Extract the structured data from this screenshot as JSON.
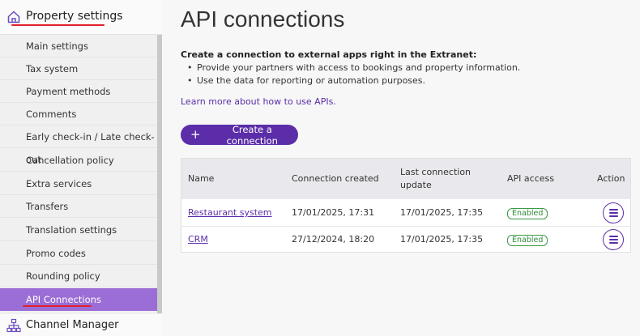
{
  "sidebar": {
    "header_title": "Property settings",
    "items": [
      {
        "label": "Main settings"
      },
      {
        "label": "Tax system"
      },
      {
        "label": "Payment methods"
      },
      {
        "label": "Comments"
      },
      {
        "label": "Early check-in / Late check-out"
      },
      {
        "label": "Cancellation policy"
      },
      {
        "label": "Extra services"
      },
      {
        "label": "Transfers"
      },
      {
        "label": "Translation settings"
      },
      {
        "label": "Promo codes"
      },
      {
        "label": "Rounding policy"
      },
      {
        "label": "API Connections"
      }
    ],
    "active_item": "API Connections",
    "footer_label": "Channel Manager",
    "active_color": "#9b6dd6"
  },
  "main": {
    "title": "API connections",
    "intro": "Create a connection to external apps right in the Extranet:",
    "bullets": [
      "Provide your partners with access to bookings and property information.",
      "Use the data for reporting or automation purposes."
    ],
    "learn_link": "Learn more about how to use APIs.",
    "create_button": "Create a connection",
    "accent_color": "#5b2da8"
  },
  "table": {
    "headers": {
      "name": "Name",
      "created": "Connection created",
      "updated_line1": "Last connection",
      "updated_line2": "update",
      "access": "API access",
      "action": "Action"
    },
    "rows": [
      {
        "name": "Restaurant system",
        "created": "17/01/2025, 17:31",
        "updated": "17/01/2025, 17:35",
        "access": "Enabled"
      },
      {
        "name": "CRM",
        "created": "27/12/2024, 18:20",
        "updated": "17/01/2025, 17:35",
        "access": "Enabled"
      }
    ],
    "status_color": "#2e8b3a"
  }
}
